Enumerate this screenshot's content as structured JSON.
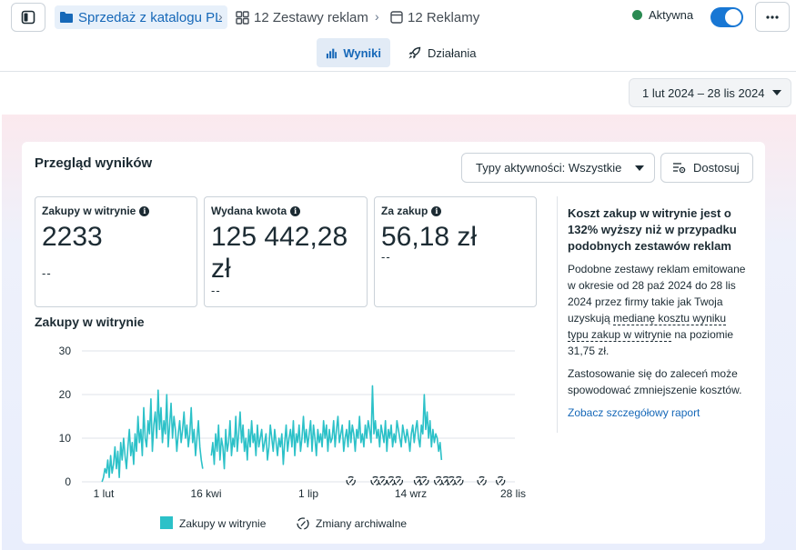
{
  "breadcrumb": {
    "campaign": "Sprzedaż z katalogu PL",
    "adsets": "12 Zestawy reklam",
    "ads": "12 Reklamy"
  },
  "status": {
    "label": "Aktywna",
    "color": "#2a8a52"
  },
  "tabs": [
    {
      "label": "Wyniki",
      "active": true
    },
    {
      "label": "Działania",
      "active": false
    }
  ],
  "date_range": "1 lut 2024 – 28 lis 2024",
  "overview": {
    "title": "Przegląd wyników",
    "filter_label": "Typy aktywności: Wszystkie",
    "customize_label": "Dostosuj"
  },
  "metrics": [
    {
      "label": "Zakupy w witrynie",
      "value": "2233",
      "sub": "--"
    },
    {
      "label": "Wydana kwota",
      "value": "125 442,28 zł",
      "sub": "--"
    },
    {
      "label": "Za zakup",
      "value": "56,18 zł",
      "sub": "--"
    }
  ],
  "insight": {
    "heading": "Koszt zakup w witrynie jest o 132% wyższy niż w przypadku podobnych zestawów reklam",
    "body_before": "Podobne zestawy reklam emitowane w okresie od 28 paź 2024 do 28 lis 2024 przez firmy takie jak Twoja uzyskują ",
    "body_link": "medianę kosztu wyniku typu zakup w witrynie",
    "body_after": " na poziomie 31,75 zł.",
    "recommendation": "Zastosowanie się do zaleceń może spowodować zmniejszenie kosztów.",
    "report_link": "Zobacz szczegółowy raport"
  },
  "chart_data": {
    "type": "line",
    "title": "Zakupy w witrynie",
    "xlabel": "",
    "ylabel": "",
    "ylim": [
      0,
      30
    ],
    "yticks": [
      0,
      10,
      20,
      30
    ],
    "xtick_labels": [
      "1 lut",
      "16 kwi",
      "1 lip",
      "14 wrz",
      "28 lis"
    ],
    "series_color": "#2cc1c8",
    "legend": [
      {
        "label": "Zakupy w witrynie",
        "kind": "series",
        "color": "#2cc1c8"
      },
      {
        "label": "Zmiany archiwalne",
        "kind": "marker"
      }
    ],
    "x_start": "2024-02-01",
    "x_end": "2024-11-28",
    "series": [
      {
        "name": "Zakupy w witrynie",
        "segments": [
          {
            "start": "2024-02-15",
            "values": [
              0,
              1,
              3,
              2,
              5,
              1,
              6,
              2,
              4,
              8,
              3,
              7,
              1,
              9,
              5,
              10,
              6,
              3,
              8,
              12,
              6,
              9,
              4,
              11,
              7,
              15,
              9,
              12,
              6,
              17,
              10,
              8,
              14,
              11,
              19,
              7,
              13,
              16,
              10,
              21,
              12,
              17,
              9,
              14,
              11,
              20,
              8,
              13,
              18,
              10,
              15,
              12,
              7,
              11,
              14,
              9,
              12,
              16,
              10,
              13,
              8,
              11,
              17,
              9,
              12,
              6,
              10,
              14,
              8,
              5,
              3
            ]
          },
          {
            "start": "2024-05-01",
            "values": [
              6,
              9,
              4,
              11,
              7,
              13,
              5,
              10,
              8,
              3,
              12,
              7,
              9,
              14,
              6,
              10,
              8,
              15,
              7,
              11,
              16,
              9,
              13,
              7,
              10,
              5,
              12,
              8,
              14,
              9,
              11,
              6,
              13,
              8,
              10,
              12,
              7,
              9,
              11,
              5,
              8,
              13,
              10,
              7,
              12,
              9,
              6,
              10,
              8,
              11,
              4,
              9,
              13,
              7,
              10,
              12,
              8,
              14,
              6,
              11,
              9,
              13,
              7,
              10,
              15,
              9,
              12,
              8,
              11,
              14,
              7,
              13,
              10,
              6,
              12,
              9,
              11,
              8,
              14,
              10,
              13,
              7,
              12,
              9,
              10,
              14,
              8,
              12,
              15,
              9,
              11,
              13,
              7,
              10,
              12,
              8,
              14,
              9,
              13,
              11,
              7,
              12,
              10,
              15,
              9,
              11,
              8,
              13,
              10,
              14,
              12,
              9,
              22,
              11,
              14,
              10,
              12,
              8,
              13,
              11,
              9,
              14,
              7,
              12,
              10,
              13,
              8,
              11,
              9,
              14,
              12,
              10,
              8,
              13,
              11,
              9,
              12,
              10,
              7,
              11,
              13,
              9,
              12,
              14,
              10,
              8,
              13,
              11,
              20,
              12,
              16,
              10,
              14,
              8,
              12,
              9,
              11,
              10,
              7,
              9,
              5
            ]
          }
        ]
      }
    ],
    "archive_change_markers": [
      "2024-08-06",
      "2024-08-23",
      "2024-08-28",
      "2024-09-03",
      "2024-09-08",
      "2024-09-22",
      "2024-09-26",
      "2024-10-06",
      "2024-10-11",
      "2024-10-15",
      "2024-10-20",
      "2024-11-05",
      "2024-11-18"
    ]
  }
}
